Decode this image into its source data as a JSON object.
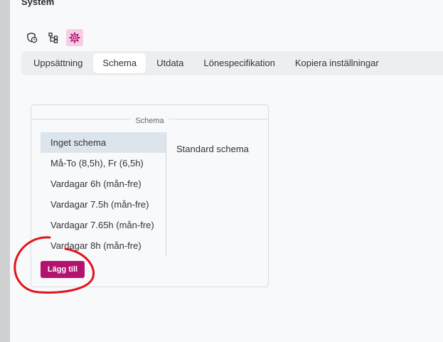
{
  "page": {
    "title": "System"
  },
  "toolbar_icons": [
    {
      "name": "clock-shield-icon",
      "active": false
    },
    {
      "name": "hierarchy-icon",
      "active": false
    },
    {
      "name": "gear-icon",
      "active": true
    }
  ],
  "tabs": [
    {
      "label": "Uppsättning",
      "active": false
    },
    {
      "label": "Schema",
      "active": true
    },
    {
      "label": "Utdata",
      "active": false
    },
    {
      "label": "Lönespecifikation",
      "active": false
    },
    {
      "label": "Kopiera inställningar",
      "active": false
    }
  ],
  "schema_panel": {
    "legend": "Schema",
    "items": [
      {
        "label": "Inget schema",
        "selected": true
      },
      {
        "label": "Må-To (8,5h), Fr (6,5h)",
        "selected": false
      },
      {
        "label": "Vardagar 6h (mån-fre)",
        "selected": false
      },
      {
        "label": "Vardagar 7.5h (mån-fre)",
        "selected": false
      },
      {
        "label": "Vardagar 7.65h (mån-fre)",
        "selected": false
      },
      {
        "label": "Vardagar 8h (mån-fre)",
        "selected": false
      }
    ],
    "detail_label": "Standard schema",
    "add_button": "Lägg till"
  },
  "colors": {
    "accent": "#b3126f",
    "active_icon_bg": "#f6cde4",
    "annotation": "#e0141b"
  }
}
